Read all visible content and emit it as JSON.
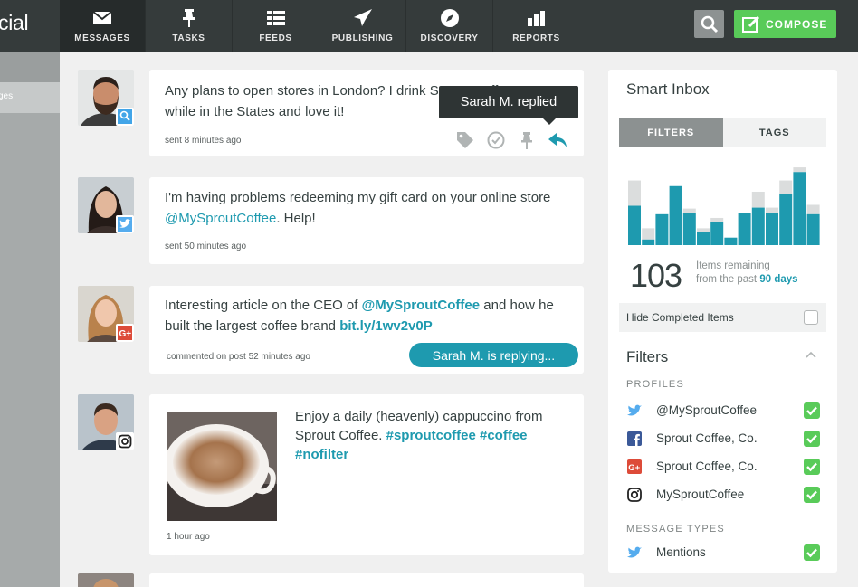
{
  "brand": {
    "text": "cial"
  },
  "nav": {
    "items": [
      {
        "label": "MESSAGES",
        "icon": "envelope-icon",
        "active": true
      },
      {
        "label": "TASKS",
        "icon": "pin-icon"
      },
      {
        "label": "FEEDS",
        "icon": "feeds-icon"
      },
      {
        "label": "PUBLISHING",
        "icon": "paper-plane-icon"
      },
      {
        "label": "DISCOVERY",
        "icon": "compass-icon"
      },
      {
        "label": "REPORTS",
        "icon": "bar-chart-icon"
      }
    ]
  },
  "header": {
    "search_icon": "search-icon",
    "compose_label": "COMPOSE"
  },
  "left_panel": {
    "item_fragment": "ges"
  },
  "feed": {
    "messages": [
      {
        "text": "Any plans to open stores in London? I drink Sprout Coffee Co while in the States and love it!",
        "meta": "sent 8 minutes ago",
        "network": "search-badge-icon",
        "tooltip": "Sarah M. replied",
        "actions": [
          "tag-icon",
          "complete-icon",
          "pin-icon",
          "reply-icon"
        ]
      },
      {
        "text_before": "I'm having problems redeeming my gift card on your online store ",
        "mention": "@MySproutCoffee",
        "text_after": ". Help!",
        "meta": "sent 50 minutes ago",
        "network": "twitter-badge-icon"
      },
      {
        "text_before": "Interesting article on the CEO of ",
        "mention": "@MySproutCoffee",
        "text_middle": " and how he built the largest coffee brand ",
        "link": "bit.ly/1wv2v0P",
        "meta": "commented on post 52 minutes ago",
        "network": "google-plus-badge-icon",
        "status": "Sarah M. is replying..."
      },
      {
        "text": "Enjoy a daily (heavenly) cappuccino from Sprout Coffee.",
        "hashtags": [
          "#sproutcoffee",
          "#coffee",
          "#nofilter"
        ],
        "meta": "1 hour ago",
        "network": "instagram-badge-icon"
      }
    ]
  },
  "smart_inbox": {
    "title": "Smart Inbox",
    "tabs": [
      {
        "label": "FILTERS",
        "active": true
      },
      {
        "label": "TAGS",
        "active": false
      }
    ],
    "chart_data": {
      "type": "bar",
      "series": [
        {
          "name": "remaining",
          "values": [
            42,
            6,
            33,
            63,
            34,
            14,
            25,
            8,
            34,
            40,
            34,
            55,
            78,
            33
          ]
        },
        {
          "name": "completed",
          "values": [
            27,
            12,
            0,
            0,
            5,
            4,
            4,
            0,
            0,
            17,
            6,
            14,
            5,
            10
          ]
        }
      ],
      "colors": {
        "remaining": "#1e9aaf",
        "completed": "#dbdddd"
      }
    },
    "count": "103",
    "remaining_label": "Items remaining",
    "period_prefix": "from the past",
    "period": "90 days",
    "hide_completed_label": "Hide Completed Items",
    "hide_completed_checked": false,
    "filters_title": "Filters",
    "profiles_header": "PROFILES",
    "profiles": [
      {
        "label": "@MySproutCoffee",
        "icon": "twitter-icon",
        "checked": true
      },
      {
        "label": "Sprout Coffee, Co.",
        "icon": "facebook-icon",
        "checked": true
      },
      {
        "label": "Sprout Coffee, Co.",
        "icon": "google-plus-icon",
        "checked": true
      },
      {
        "label": "MySproutCoffee",
        "icon": "instagram-icon",
        "checked": true
      }
    ],
    "message_types_header": "MESSAGE TYPES",
    "message_types": [
      {
        "label": "Mentions",
        "icon": "twitter-icon",
        "checked": true
      }
    ]
  },
  "colors": {
    "accent": "#1e9aaf",
    "compose": "#59cb59",
    "topbar": "#353b3b"
  }
}
